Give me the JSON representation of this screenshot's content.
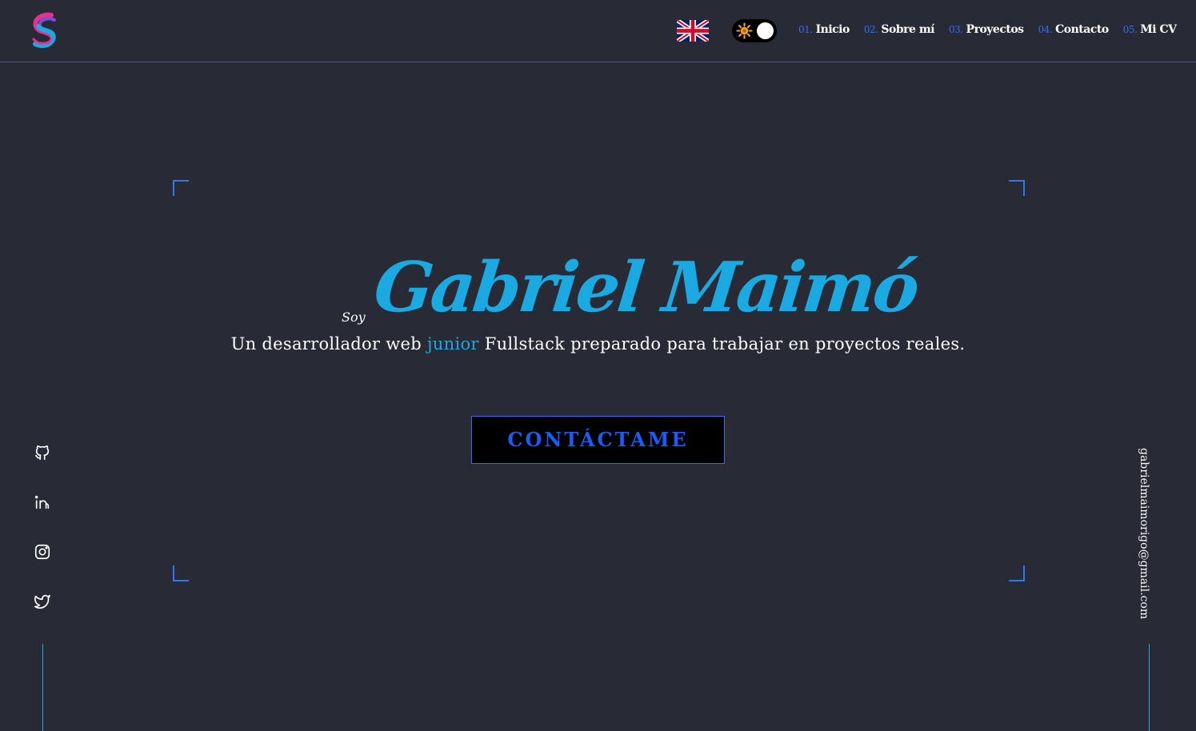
{
  "header": {
    "nav": [
      {
        "num": "01.",
        "label": "Inicio"
      },
      {
        "num": "02.",
        "label": "Sobre mí"
      },
      {
        "num": "03.",
        "label": "Proyectos"
      },
      {
        "num": "04.",
        "label": "Contacto"
      },
      {
        "num": "05.",
        "label": "Mi CV"
      }
    ],
    "language_icon": "uk-flag-icon",
    "theme_icon": "sun-icon"
  },
  "hero": {
    "intro": "Soy",
    "name": "Gabriel Maimó",
    "tagline_before": "Un desarrollador web ",
    "tagline_accent": "junior",
    "tagline_after": " Fullstack preparado para trabajar en proyectos reales.",
    "cta_label": "CONTÁCTAME"
  },
  "social": [
    "github-icon",
    "linkedin-icon",
    "instagram-icon",
    "twitter-icon"
  ],
  "email": "gabrielmaimorigo@gmail.com",
  "colors": {
    "background": "#282a35",
    "accent": "#1aa9e0",
    "brand_blue": "#2f6ff0"
  }
}
